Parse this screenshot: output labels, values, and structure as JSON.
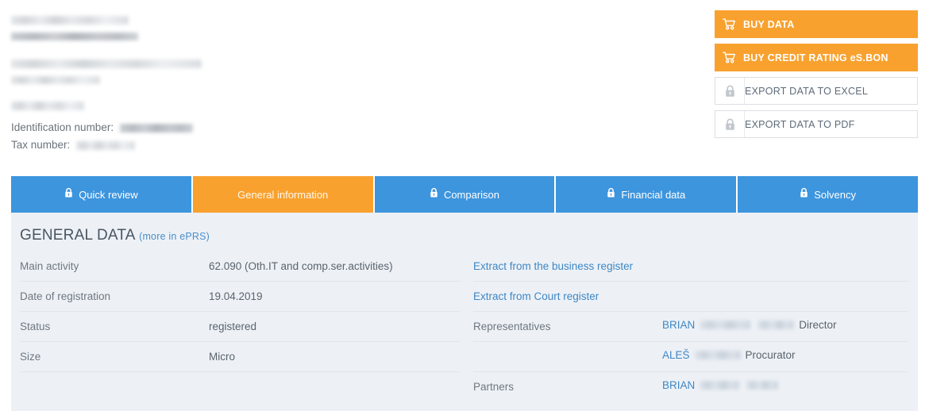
{
  "company_header": {
    "redacted_name_lines": [
      "redacted-name-1",
      "redacted-name-2",
      "redacted-name-3"
    ],
    "redacted_address_lines": [
      "redacted-address-1",
      "redacted-address-2"
    ],
    "redacted_city_line": "redacted-city",
    "identification_label": "Identification number:",
    "identification_value": "",
    "tax_label": "Tax number:",
    "tax_value": ""
  },
  "actions": {
    "buy_data": {
      "label": "BUY DATA",
      "icon": "shopping-cart-icon",
      "style": "primary"
    },
    "buy_credit_rating": {
      "label": "BUY CREDIT RATING eS.BON",
      "icon": "shopping-cart-icon",
      "style": "primary"
    },
    "export_excel": {
      "label": "EXPORT DATA TO EXCEL",
      "icon": "lock-icon",
      "style": "secondary"
    },
    "export_pdf": {
      "label": "EXPORT DATA TO PDF",
      "icon": "lock-icon",
      "style": "secondary"
    }
  },
  "tabs": [
    {
      "label": "Quick review",
      "icon": "lock-icon",
      "locked": true,
      "active": false
    },
    {
      "label": "General information",
      "icon": "",
      "locked": false,
      "active": true
    },
    {
      "label": "Comparison",
      "icon": "lock-icon",
      "locked": true,
      "active": false
    },
    {
      "label": "Financial data",
      "icon": "lock-icon",
      "locked": true,
      "active": false
    },
    {
      "label": "Solvency",
      "icon": "lock-icon",
      "locked": true,
      "active": false
    }
  ],
  "panel": {
    "title": "GENERAL DATA",
    "more_link": "(more in ePRS)",
    "left_rows": [
      {
        "key": "Main activity",
        "value": "62.090 (Oth.IT and comp.ser.activities)"
      },
      {
        "key": "Date of registration",
        "value": "19.04.2019"
      },
      {
        "key": "Status",
        "value": "registered"
      },
      {
        "key": "Size",
        "value": "Micro"
      }
    ],
    "right_links": [
      {
        "label": "Extract from the business register"
      },
      {
        "label": "Extract from Court register"
      }
    ],
    "representatives": {
      "key": "Representatives",
      "people": [
        {
          "first_name": "BRIAN",
          "surname_redacted": true,
          "role": "Director"
        },
        {
          "first_name": "ALEŠ",
          "surname_redacted": true,
          "role": "Procurator"
        }
      ]
    },
    "partners": {
      "key": "Partners",
      "people": [
        {
          "first_name": "BRIAN",
          "surname_redacted": true,
          "role": ""
        }
      ]
    }
  },
  "colors": {
    "brand_orange": "#f9a12e",
    "brand_blue": "#3d95de",
    "panel_background": "#edf1f6",
    "link_blue": "#3f87c4",
    "text_gray": "#5a636c",
    "divider": "#dfe5ec"
  }
}
